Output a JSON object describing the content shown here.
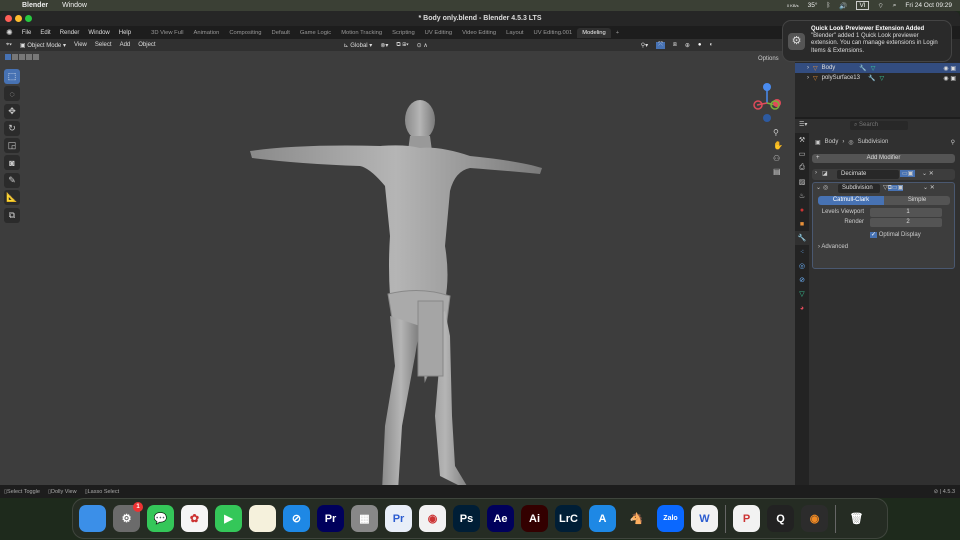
{
  "menubar": {
    "app": "Blender",
    "window": "Window",
    "temp": "35°",
    "kb_up": "0 KB/s",
    "kb_down": "0 KB/s",
    "input": "VI",
    "datetime": "Fri 24 Oct  09:29"
  },
  "window": {
    "title": "* Body only.blend - Blender 4.5.3 LTS"
  },
  "topbar": {
    "menus": [
      "File",
      "Edit",
      "Render",
      "Window",
      "Help"
    ],
    "workspaces": [
      "3D View Full",
      "Animation",
      "Compositing",
      "Default",
      "Game Logic",
      "Motion Tracking",
      "Scripting",
      "UV Editing",
      "Video Editing",
      "Layout",
      "UV Editing.001",
      "Modeling"
    ],
    "active_workspace": "Modeling",
    "add_tab": "+"
  },
  "viewport_header": {
    "mode": "Object Mode",
    "menus": [
      "View",
      "Select",
      "Add",
      "Object"
    ],
    "orientation": "Global",
    "options": "Options"
  },
  "toolbar": {
    "tools": [
      "select-box",
      "cursor",
      "move",
      "rotate",
      "scale",
      "transform",
      "annotate",
      "measure",
      "add-cube"
    ]
  },
  "outliner": {
    "items": [
      {
        "name": "Body",
        "selected": true
      },
      {
        "name": "polySurface13",
        "selected": false
      }
    ]
  },
  "properties": {
    "search_placeholder": "Search",
    "breadcrumb_object": "Body",
    "breadcrumb_modifier": "Subdivision",
    "add_modifier": "Add Modifier",
    "modifiers": [
      {
        "name": "Decimate",
        "expanded": false
      },
      {
        "name": "Subdivision",
        "expanded": true
      }
    ],
    "subdiv": {
      "type_options": [
        "Catmull-Clark",
        "Simple"
      ],
      "active_type": "Catmull-Clark",
      "levels_viewport_label": "Levels Viewport",
      "levels_viewport": "1",
      "render_label": "Render",
      "render": "2",
      "optimal_display_label": "Optimal Display",
      "optimal_display": true,
      "advanced_label": "Advanced"
    }
  },
  "status": {
    "items": [
      "Select Toggle",
      "Dolly View",
      "Lasso Select"
    ],
    "version": "4.5.3"
  },
  "notification": {
    "title": "Quick Look Previewer Extension Added",
    "body": "\"Blender\" added 1 Quick Look previewer extension. You can manage extensions in Login Items & Extensions."
  },
  "dock": {
    "badge": "1",
    "apps": [
      {
        "name": "Finder",
        "label": "",
        "color": "#3b8fe8"
      },
      {
        "name": "System Settings",
        "label": "⚙",
        "color": "#6b6b6b"
      },
      {
        "name": "Messages",
        "label": "💬",
        "color": "#34c759"
      },
      {
        "name": "Photos",
        "label": "✿",
        "color": "#f5f5f5"
      },
      {
        "name": "FaceTime",
        "label": "▶",
        "color": "#34c759"
      },
      {
        "name": "Notes",
        "label": "",
        "color": "#f5f1dc"
      },
      {
        "name": "Safari",
        "label": "⊘",
        "color": "#1e88e5"
      },
      {
        "name": "Premiere Pro",
        "label": "Pr",
        "color": "#00005b"
      },
      {
        "name": "Launchpad",
        "label": "▦",
        "color": "#888"
      },
      {
        "name": "Premiere Rush",
        "label": "Pr",
        "color": "#e8eef8"
      },
      {
        "name": "Chrome",
        "label": "◉",
        "color": "#f2f2f2"
      },
      {
        "name": "Photoshop",
        "label": "Ps",
        "color": "#001e36"
      },
      {
        "name": "After Effects",
        "label": "Ae",
        "color": "#00005b"
      },
      {
        "name": "Illustrator",
        "label": "Ai",
        "color": "#330000"
      },
      {
        "name": "Lightroom Classic",
        "label": "LrC",
        "color": "#001e36"
      },
      {
        "name": "App Store",
        "label": "A",
        "color": "#1e88e5"
      },
      {
        "name": "Horse",
        "label": "🐴",
        "color": "transparent"
      },
      {
        "name": "Zalo",
        "label": "Zalo",
        "color": "#0a68ff"
      },
      {
        "name": "Word",
        "label": "W",
        "color": "#f2f2f2"
      },
      {
        "name": "PowerPoint",
        "label": "P",
        "color": "#f2f2f2"
      },
      {
        "name": "QuickTime",
        "label": "Q",
        "color": "#222"
      },
      {
        "name": "Blender",
        "label": "◉",
        "color": "#2c2c2c"
      },
      {
        "name": "Trash",
        "label": "🗑",
        "color": "transparent"
      }
    ]
  }
}
